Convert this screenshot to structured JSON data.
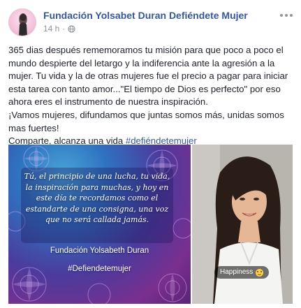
{
  "post": {
    "page_name": "Fundación Yolsabet Duran Defiéndete Mujer",
    "time": "14 h",
    "separator": "·",
    "paragraphs": [
      "365 dias después rememoramos tu misión para que poco a poco el mundo despierte del letargo y la indiferencia ante la agresión a la mujer. Tu vida y la de otras mujeres fue el precio a pagar para iniciar esta tarea con tanto amor...\"El tiempo de Dios es perfecto\" por eso ahora eres el instrumento de nuestra inspiración.",
      "¡Vamos mujeres, difundamos que juntas somos más, unidas somos mas fuertes!"
    ],
    "closing_text": "Comparte, alcanza una vida ",
    "closing_hashtag": "#defiéndetemujer"
  },
  "media": {
    "graphic": {
      "quote": "Tú, el principio de una lucha, tu vida, la inspiración para muchas, y hoy en este día te recordamos como el estandarte de una consigna, una voz que no será callada jamás.",
      "org_name": "Fundación Yolsabeth Duran",
      "hashtag": "#Defiendetemujer"
    },
    "photo": {
      "sticker_text": "Happiness",
      "sticker_icon": "smiling-emoji-icon"
    }
  },
  "icons": {
    "options": "ellipsis-icon",
    "privacy": "globe-icon",
    "avatar": "page-avatar"
  },
  "colors": {
    "link": "#365899",
    "meta": "#90949c",
    "text": "#1d2129"
  }
}
